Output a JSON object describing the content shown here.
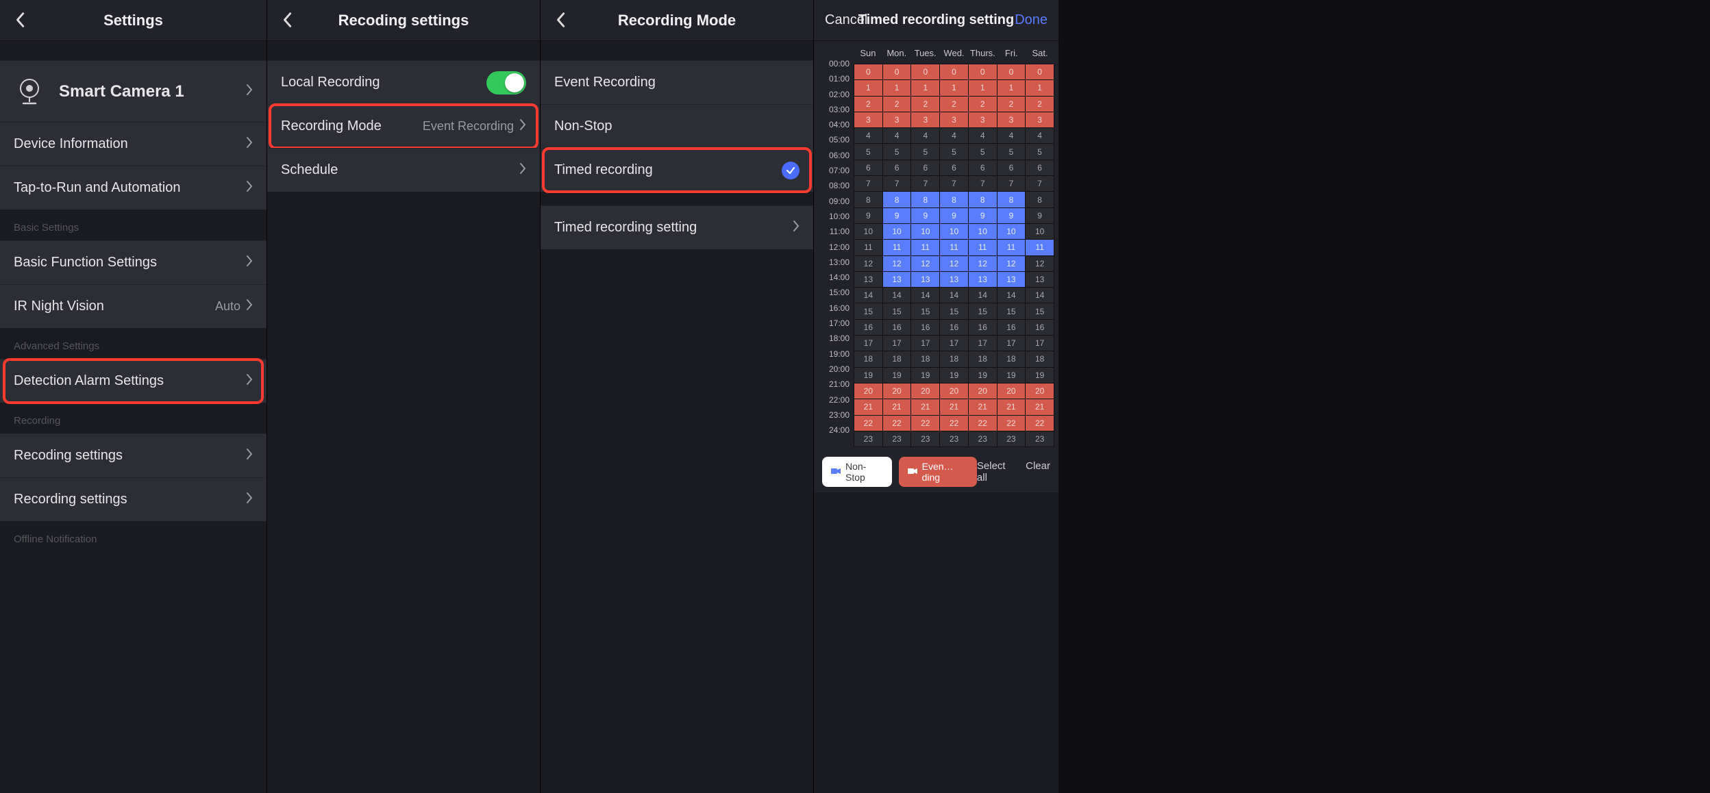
{
  "screen1": {
    "title": "Settings",
    "device_name": "Smart Camera 1",
    "rows": {
      "device_info": "Device Information",
      "automation": "Tap-to-Run and Automation",
      "basic_header": "Basic Settings",
      "basic_func": "Basic Function Settings",
      "ir": "IR Night Vision",
      "ir_val": "Auto",
      "adv_header": "Advanced Settings",
      "detect": "Detection Alarm Settings",
      "rec_header": "Recording",
      "rec1": "Recoding settings",
      "rec2": "Recording settings",
      "offline": "Offline Notification"
    }
  },
  "screen2": {
    "title": "Recoding settings",
    "local": "Local Recording",
    "mode": "Recording Mode",
    "mode_val": "Event Recording",
    "schedule": "Schedule"
  },
  "screen3": {
    "title": "Recording Mode",
    "event": "Event Recording",
    "nonstop": "Non-Stop",
    "timed": "Timed recording",
    "timed_setting": "Timed recording setting"
  },
  "screen4": {
    "cancel": "Cancel",
    "title": "Timed recording setting",
    "done": "Done",
    "days": [
      "Sun",
      "Mon.",
      "Tues.",
      "Wed.",
      "Thurs.",
      "Fri.",
      "Sat."
    ],
    "hours": [
      "00:00",
      "01:00",
      "02:00",
      "03:00",
      "04:00",
      "05:00",
      "06:00",
      "07:00",
      "08:00",
      "09:00",
      "10:00",
      "11:00",
      "12:00",
      "13:00",
      "14:00",
      "15:00",
      "16:00",
      "17:00",
      "18:00",
      "19:00",
      "20:00",
      "21:00",
      "22:00",
      "23:00",
      "24:00"
    ],
    "legend_nonstop": "Non-Stop",
    "legend_event": "Even…ding",
    "select_all": "Select all",
    "clear": "Clear",
    "schedule_comment": "cell states per hour-row: ev=event(red), ns=nonstop(blue), 0=none; 24 rows x 7 days",
    "cells": [
      [
        "ev",
        "ev",
        "ev",
        "ev",
        "ev",
        "ev",
        "ev"
      ],
      [
        "ev",
        "ev",
        "ev",
        "ev",
        "ev",
        "ev",
        "ev"
      ],
      [
        "ev",
        "ev",
        "ev",
        "ev",
        "ev",
        "ev",
        "ev"
      ],
      [
        "ev",
        "ev",
        "ev",
        "ev",
        "ev",
        "ev",
        "ev"
      ],
      [
        "",
        "",
        "",
        "",
        "",
        "",
        ""
      ],
      [
        "",
        "",
        "",
        "",
        "",
        "",
        ""
      ],
      [
        "",
        "",
        "",
        "",
        "",
        "",
        ""
      ],
      [
        "",
        "",
        "",
        "",
        "",
        "",
        ""
      ],
      [
        "",
        "ns",
        "ns",
        "ns",
        "ns",
        "ns",
        ""
      ],
      [
        "",
        "ns",
        "ns",
        "ns",
        "ns",
        "ns",
        ""
      ],
      [
        "",
        "ns",
        "ns",
        "ns",
        "ns",
        "ns",
        ""
      ],
      [
        "",
        "ns",
        "ns",
        "ns",
        "ns",
        "ns",
        "ns"
      ],
      [
        "",
        "ns",
        "ns",
        "ns",
        "ns",
        "ns",
        ""
      ],
      [
        "",
        "ns",
        "ns",
        "ns",
        "ns",
        "ns",
        ""
      ],
      [
        "",
        "",
        "",
        "",
        "",
        "",
        ""
      ],
      [
        "",
        "",
        "",
        "",
        "",
        "",
        ""
      ],
      [
        "",
        "",
        "",
        "",
        "",
        "",
        ""
      ],
      [
        "",
        "",
        "",
        "",
        "",
        "",
        ""
      ],
      [
        "",
        "",
        "",
        "",
        "",
        "",
        ""
      ],
      [
        "",
        "",
        "",
        "",
        "",
        "",
        ""
      ],
      [
        "ev",
        "ev",
        "ev",
        "ev",
        "ev",
        "ev",
        "ev"
      ],
      [
        "ev",
        "ev",
        "ev",
        "ev",
        "ev",
        "ev",
        "ev"
      ],
      [
        "ev",
        "ev",
        "ev",
        "ev",
        "ev",
        "ev",
        "ev"
      ],
      [
        "",
        "",
        "",
        "",
        "",
        "",
        ""
      ]
    ]
  }
}
